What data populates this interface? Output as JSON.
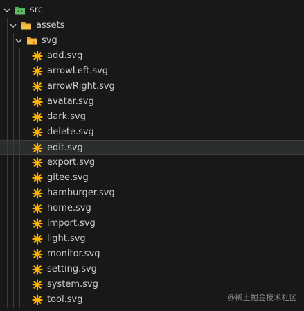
{
  "tree": {
    "root_folder": {
      "label": "src",
      "expanded": true,
      "icon": "folder-src-open-icon",
      "icon_color": "#4caf50"
    },
    "assets_folder": {
      "label": "assets",
      "expanded": true,
      "icon": "folder-open-icon",
      "icon_color": "#f4c046"
    },
    "svg_folder": {
      "label": "svg",
      "expanded": true,
      "icon": "folder-svg-open-icon",
      "icon_color": "#f4c046"
    },
    "files": [
      {
        "label": "add.svg",
        "icon": "svg-file-icon"
      },
      {
        "label": "arrowLeft.svg",
        "icon": "svg-file-icon"
      },
      {
        "label": "arrowRight.svg",
        "icon": "svg-file-icon"
      },
      {
        "label": "avatar.svg",
        "icon": "svg-file-icon"
      },
      {
        "label": "dark.svg",
        "icon": "svg-file-icon"
      },
      {
        "label": "delete.svg",
        "icon": "svg-file-icon"
      },
      {
        "label": "edit.svg",
        "icon": "svg-file-icon",
        "selected": true
      },
      {
        "label": "export.svg",
        "icon": "svg-file-icon"
      },
      {
        "label": "gitee.svg",
        "icon": "svg-file-icon"
      },
      {
        "label": "hamburger.svg",
        "icon": "svg-file-icon"
      },
      {
        "label": "home.svg",
        "icon": "svg-file-icon"
      },
      {
        "label": "import.svg",
        "icon": "svg-file-icon"
      },
      {
        "label": "light.svg",
        "icon": "svg-file-icon"
      },
      {
        "label": "monitor.svg",
        "icon": "svg-file-icon"
      },
      {
        "label": "setting.svg",
        "icon": "svg-file-icon"
      },
      {
        "label": "system.svg",
        "icon": "svg-file-icon"
      },
      {
        "label": "tool.svg",
        "icon": "svg-file-icon"
      }
    ]
  },
  "watermark": {
    "text": "@稀土掘金技术社区"
  },
  "colors": {
    "background": "#181818",
    "text": "#cccccc",
    "selected_row": "#2a2d2e",
    "indent_guide": "#3b3b3b",
    "svg_icon": "#ffb300"
  }
}
